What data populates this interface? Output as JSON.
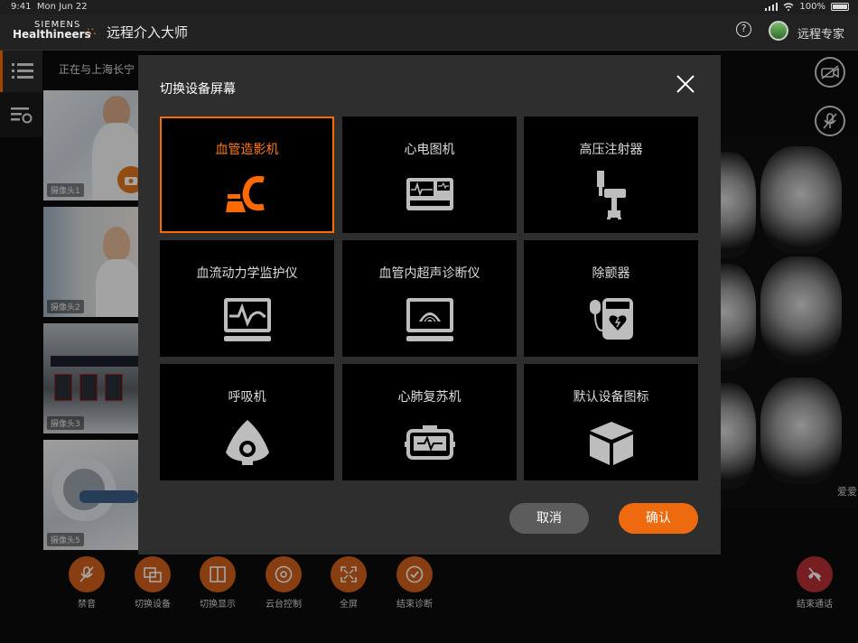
{
  "status_bar": {
    "time": "9:41",
    "date": "Mon Jun 22",
    "battery": "100%"
  },
  "header": {
    "logo_line1": "SIEMENS",
    "logo_line2": "Healthineers",
    "app_title": "远程介入大师",
    "help_glyph": "?",
    "user_name": "远程专家"
  },
  "connection_text": "正在与上海长宁",
  "cameras": [
    {
      "label": "摄像头1"
    },
    {
      "label": "摄像头2"
    },
    {
      "label": "摄像头3"
    },
    {
      "label": "摄像头5"
    }
  ],
  "mri_watermark": "爱爱",
  "modal": {
    "title": "切换设备屏幕",
    "selected_index": 0,
    "devices": [
      {
        "label": "血管造影机",
        "icon": "angiography-icon"
      },
      {
        "label": "心电图机",
        "icon": "ecg-machine-icon"
      },
      {
        "label": "高压注射器",
        "icon": "injector-icon"
      },
      {
        "label": "血流动力学监护仪",
        "icon": "hemodynamic-monitor-icon"
      },
      {
        "label": "血管内超声诊断仪",
        "icon": "ultrasound-icon"
      },
      {
        "label": "除颤器",
        "icon": "defibrillator-icon"
      },
      {
        "label": "呼吸机",
        "icon": "ventilator-icon"
      },
      {
        "label": "心肺复苏机",
        "icon": "cpr-machine-icon"
      },
      {
        "label": "默认设备图标",
        "icon": "default-device-icon"
      }
    ],
    "cancel_label": "取消",
    "confirm_label": "确认"
  },
  "bottom_bar": {
    "buttons": [
      {
        "label": "禁音",
        "icon": "mic-mute-icon"
      },
      {
        "label": "切换设备",
        "icon": "switch-device-icon"
      },
      {
        "label": "切换显示",
        "icon": "switch-display-icon"
      },
      {
        "label": "云台控制",
        "icon": "ptz-control-icon"
      },
      {
        "label": "全屏",
        "icon": "fullscreen-icon"
      },
      {
        "label": "结束诊断",
        "icon": "end-diagnosis-icon"
      }
    ],
    "end_call_label": "结束通话"
  },
  "colors": {
    "accent": "#ff6a00",
    "end_call": "#b52e34",
    "modal_bg": "#2e2e2e"
  }
}
